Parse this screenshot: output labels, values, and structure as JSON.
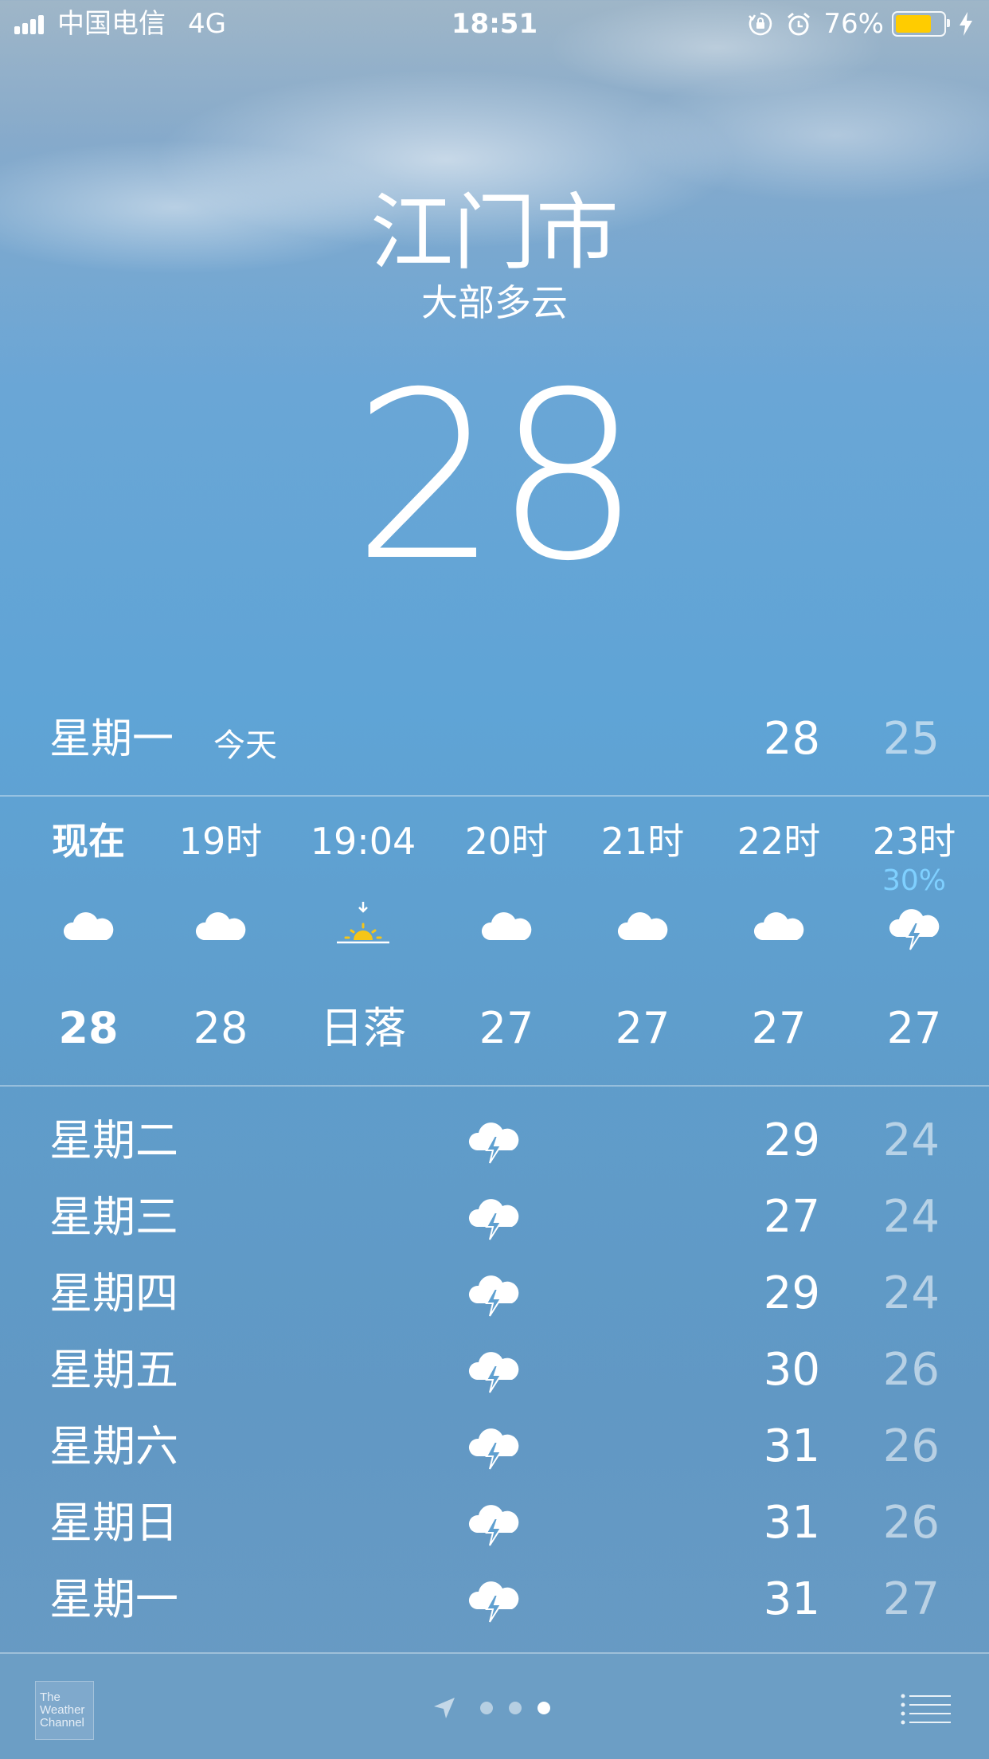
{
  "status_bar": {
    "carrier": "中国电信",
    "network": "4G",
    "time": "18:51",
    "battery_percent": "76%",
    "battery_level": 0.76
  },
  "location": {
    "city": "江门市",
    "condition": "大部多云",
    "temperature": "28"
  },
  "today": {
    "day": "星期一",
    "tag": "今天",
    "high": "28",
    "low": "25"
  },
  "hourly": [
    {
      "label": "现在",
      "icon": "cloud-icon",
      "pop": "",
      "temp": "28"
    },
    {
      "label": "19时",
      "icon": "cloud-icon",
      "pop": "",
      "temp": "28"
    },
    {
      "label": "19:04",
      "icon": "sunset-icon",
      "pop": "",
      "temp": "日落"
    },
    {
      "label": "20时",
      "icon": "cloud-icon",
      "pop": "",
      "temp": "27"
    },
    {
      "label": "21时",
      "icon": "cloud-icon",
      "pop": "",
      "temp": "27"
    },
    {
      "label": "22时",
      "icon": "cloud-icon",
      "pop": "",
      "temp": "27"
    },
    {
      "label": "23时",
      "icon": "thunderstorm-icon",
      "pop": "30%",
      "temp": "27"
    }
  ],
  "daily": [
    {
      "day": "星期二",
      "icon": "thunderstorm-icon",
      "high": "29",
      "low": "24"
    },
    {
      "day": "星期三",
      "icon": "thunderstorm-icon",
      "high": "27",
      "low": "24"
    },
    {
      "day": "星期四",
      "icon": "thunderstorm-icon",
      "high": "29",
      "low": "24"
    },
    {
      "day": "星期五",
      "icon": "thunderstorm-icon",
      "high": "30",
      "low": "26"
    },
    {
      "day": "星期六",
      "icon": "thunderstorm-icon",
      "high": "31",
      "low": "26"
    },
    {
      "day": "星期日",
      "icon": "thunderstorm-icon",
      "high": "31",
      "low": "26"
    },
    {
      "day": "星期一",
      "icon": "thunderstorm-icon",
      "high": "31",
      "low": "27"
    }
  ],
  "footer": {
    "logo_lines": [
      "The",
      "Weather",
      "Channel"
    ],
    "page_count": 3,
    "active_page": 3
  },
  "colors": {
    "sun": "#f5c518",
    "precip": "#7fd0ff",
    "battery": "#ffcc00"
  }
}
